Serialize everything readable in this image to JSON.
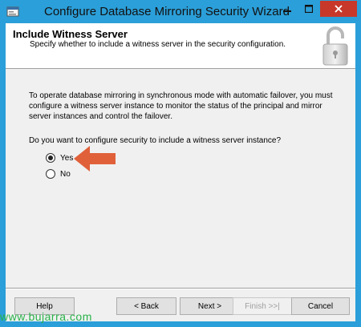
{
  "window": {
    "title": "Configure Database Mirroring Security Wizard",
    "icon": "wizard-app-icon",
    "accent_color": "#2b9fd9",
    "close_color": "#c7382b"
  },
  "header": {
    "title": "Include Witness Server",
    "subtitle": "Specify whether to include a witness server in the security configuration.",
    "icon": "padlock-icon"
  },
  "body": {
    "description": "To operate database mirroring in synchronous mode with automatic failover, you must configure a witness server instance to monitor the status of the principal and mirror server instances and control the failover.",
    "question": "Do you want to configure security to include a witness server instance?",
    "options": [
      {
        "label": "Yes",
        "selected": true
      },
      {
        "label": "No",
        "selected": false
      }
    ],
    "annotation_arrow_color": "#e0603a"
  },
  "footer": {
    "help_label": "Help",
    "back_label": "< Back",
    "next_label": "Next >",
    "finish_label": "Finish >>|",
    "cancel_label": "Cancel",
    "finish_enabled": false
  },
  "watermark": {
    "text": "www.bujarra.com",
    "color": "#29b34a"
  }
}
